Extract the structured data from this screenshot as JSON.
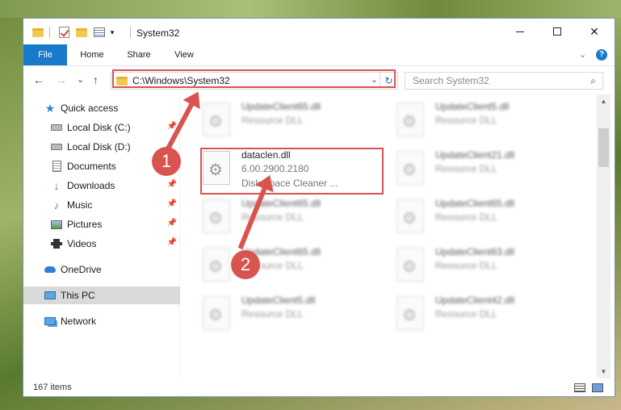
{
  "window": {
    "title": "System32",
    "close_glyph": "✕",
    "minimize_label": "",
    "dropdown_glyph": "▾"
  },
  "ribbon": {
    "tabs": [
      {
        "label": "File"
      },
      {
        "label": "Home"
      },
      {
        "label": "Share"
      },
      {
        "label": "View"
      }
    ],
    "expand_glyph": "⌄",
    "help_glyph": "?"
  },
  "nav": {
    "back_glyph": "←",
    "forward_glyph": "→",
    "recent_glyph": "⌄",
    "up_glyph": "↑",
    "address": "C:\\Windows\\System32",
    "address_dropdown_glyph": "⌄",
    "refresh_glyph": "↻",
    "search_placeholder": "Search System32",
    "search_glyph": "⌕"
  },
  "sidebar": {
    "items": [
      {
        "label": "Quick access",
        "icon": "star-icon"
      },
      {
        "label": "Local Disk (C:)",
        "icon": "drive-icon",
        "pinned": true
      },
      {
        "label": "Local Disk (D:)",
        "icon": "drive-icon"
      },
      {
        "label": "Documents",
        "icon": "documents-icon",
        "pinned": true
      },
      {
        "label": "Downloads",
        "icon": "download-icon",
        "pinned": true
      },
      {
        "label": "Music",
        "icon": "music-icon",
        "pinned": true
      },
      {
        "label": "Pictures",
        "icon": "pictures-icon",
        "pinned": true
      },
      {
        "label": "Videos",
        "icon": "videos-icon",
        "pinned": true
      },
      {
        "label": "OneDrive",
        "icon": "onedrive-icon"
      },
      {
        "label": "This PC",
        "icon": "this-pc-icon",
        "selected": true
      },
      {
        "label": "Network",
        "icon": "network-icon"
      }
    ],
    "pin_glyph": "📌"
  },
  "files": {
    "left_column": [
      {
        "name": "UpdateClient65.dll",
        "desc": "Resource DLL",
        "sub": "",
        "blurred": true
      },
      {
        "name": "dataclen.dll",
        "desc": "6.00.2900.2180",
        "sub": "Disk Space Cleaner ...",
        "blurred": false
      },
      {
        "name": "UpdateClient65.dll",
        "desc": "Resource DLL",
        "sub": "",
        "blurred": true
      },
      {
        "name": "UpdateClient65.dll",
        "desc": "Resource DLL",
        "sub": "",
        "blurred": true
      },
      {
        "name": "UpdateClient5.dll",
        "desc": "Resource DLL",
        "sub": "",
        "blurred": true
      }
    ],
    "right_column": [
      {
        "name": "UpdateClient5.dll",
        "desc": "Resource DLL",
        "sub": "",
        "blurred": true
      },
      {
        "name": "UpdateClient21.dll",
        "desc": "Resource DLL",
        "sub": "",
        "blurred": true
      },
      {
        "name": "UpdateClient65.dll",
        "desc": "Resource DLL",
        "sub": "",
        "blurred": true
      },
      {
        "name": "UpdateClient63.dll",
        "desc": "Resource DLL",
        "sub": "",
        "blurred": true
      },
      {
        "name": "UpdateClient42.dll",
        "desc": "Resource DLL",
        "sub": "",
        "blurred": true
      }
    ]
  },
  "scrollbar": {
    "up_glyph": "▲",
    "down_glyph": "▼"
  },
  "status": {
    "items_count": "167 items"
  },
  "annotations": {
    "step1": "1",
    "step2": "2"
  },
  "colors": {
    "accent": "#1979ca",
    "highlight": "#d9534f"
  }
}
